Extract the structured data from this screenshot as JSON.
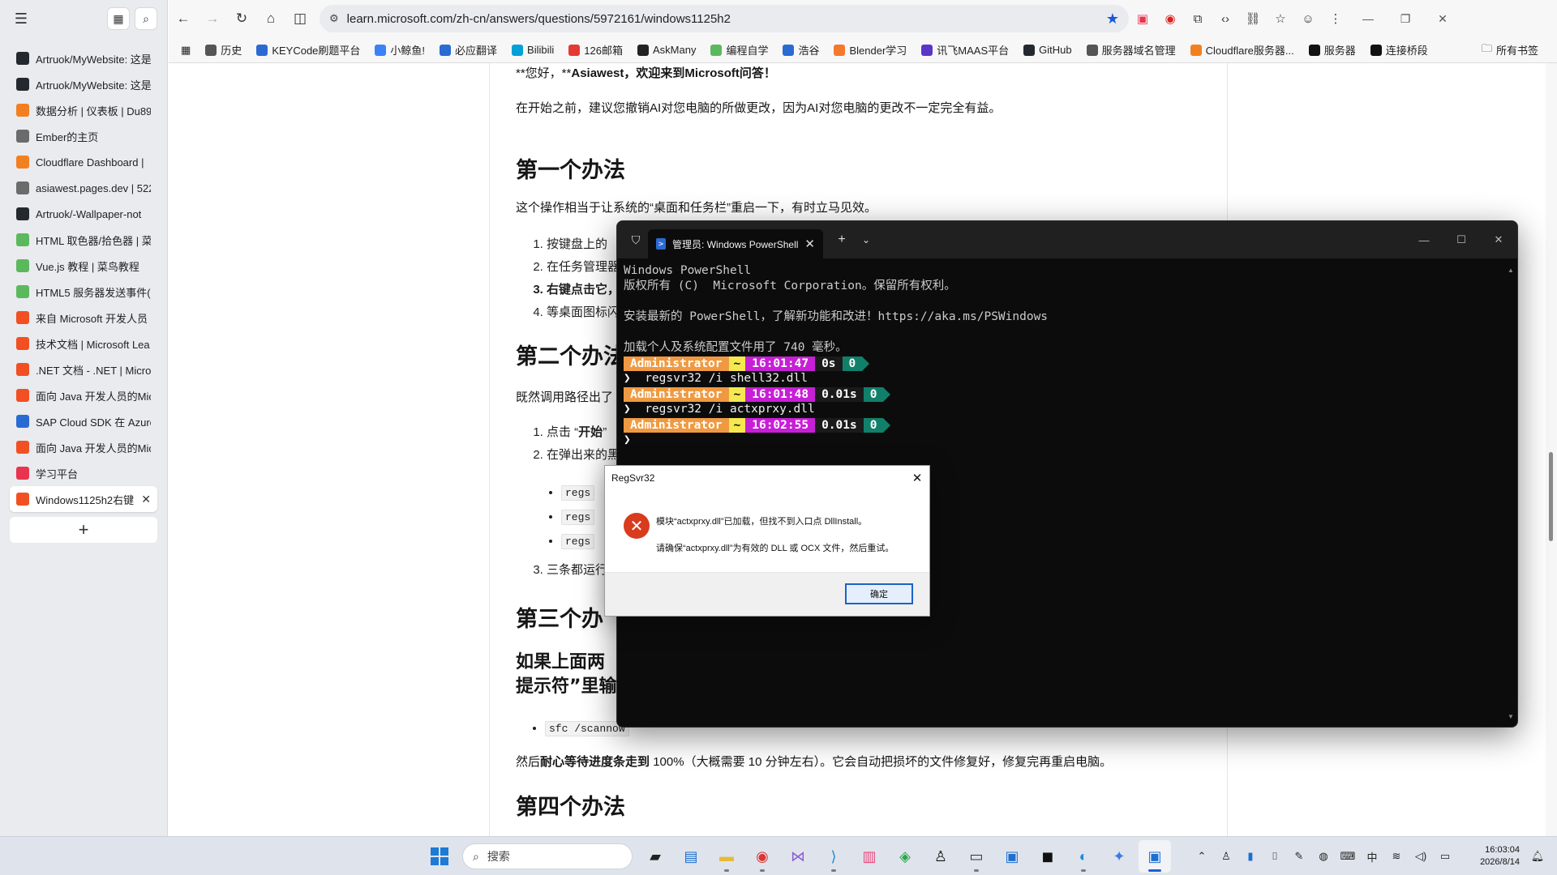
{
  "sidebar": {
    "items": [
      {
        "label": "Artruok/MyWebsite: 这是",
        "color": "#24292f"
      },
      {
        "label": "Artruok/MyWebsite: 这是",
        "color": "#24292f"
      },
      {
        "label": "数据分析 | 仪表板 | Du89",
        "color": "#f38020"
      },
      {
        "label": "Ember的主页",
        "color": "#6b6b6b"
      },
      {
        "label": "Cloudflare Dashboard | ",
        "color": "#f38020"
      },
      {
        "label": "asiawest.pages.dev | 522",
        "color": "#6b6b6b"
      },
      {
        "label": "Artruok/-Wallpaper-not",
        "color": "#24292f"
      },
      {
        "label": "HTML 取色器/拾色器 | 菜",
        "color": "#5cb85c"
      },
      {
        "label": "Vue.js 教程 | 菜鸟教程",
        "color": "#5cb85c"
      },
      {
        "label": "HTML5 服务器发送事件(S",
        "color": "#5cb85c"
      },
      {
        "label": "来自 Microsoft 开发人员",
        "color": "#f25022"
      },
      {
        "label": "技术文档 | Microsoft Lea",
        "color": "#f25022"
      },
      {
        "label": ".NET 文档 - .NET | Micro",
        "color": "#f25022"
      },
      {
        "label": "面向 Java 开发人员的Mic",
        "color": "#f25022"
      },
      {
        "label": "SAP Cloud SDK 在 Azure",
        "color": "#2a6bd3"
      },
      {
        "label": "面向 Java 开发人员的Mic",
        "color": "#f25022"
      },
      {
        "label": "学习平台",
        "color": "#e8344e"
      },
      {
        "label": "Windows1125h2右键",
        "color": "#f25022"
      }
    ],
    "new_tab": "+"
  },
  "topbar": {
    "url": "learn.microsoft.com/zh-cn/answers/questions/5972161/windows1125h2"
  },
  "bookmarks": [
    {
      "label": "历史",
      "color": "#555"
    },
    {
      "label": "KEYCode刷题平台",
      "color": "#2a6bd3"
    },
    {
      "label": "小鲸鱼!",
      "color": "#3b82f6"
    },
    {
      "label": "必应翻译",
      "color": "#2a6bd3"
    },
    {
      "label": "Bilibili",
      "color": "#00a1d6"
    },
    {
      "label": "126邮箱",
      "color": "#e53935"
    },
    {
      "label": "AskMany",
      "color": "#222"
    },
    {
      "label": "编程自学",
      "color": "#5cb85c"
    },
    {
      "label": "浩谷",
      "color": "#2a6bd3"
    },
    {
      "label": "Blender学习",
      "color": "#f5792a"
    },
    {
      "label": "讯飞MAAS平台",
      "color": "#5b34c9"
    },
    {
      "label": "GitHub",
      "color": "#24292f"
    },
    {
      "label": "服务器域名管理",
      "color": "#555"
    },
    {
      "label": "Cloudflare服务器...",
      "color": "#f38020"
    },
    {
      "label": "服务器",
      "color": "#111"
    },
    {
      "label": "连接桥段",
      "color": "#111"
    }
  ],
  "bookmarks_all": "所有书签",
  "article": {
    "greeting_prefix": "**您好，**",
    "greeting_name": "Asiawest",
    "greeting_suffix": "，欢迎来到Microsoft问答！",
    "intro": "在开始之前，建议您撤销AI对您电脑的所做更改，因为AI对您电脑的更改不一定完全有益。",
    "h_method1": "第一个办法",
    "m1_desc": "这个操作相当于让系统的“桌面和任务栏”重启一下，有时立马见效。",
    "m1_steps": [
      "按键盘上的",
      "在任务管理器",
      "右键点击它，",
      "等桌面图标闪"
    ],
    "h_method2": "第二个办法",
    "m2_desc": "既然调用路径出了",
    "m2_step1_a": "点击 “",
    "m2_step1_b": "开始",
    "m2_step1_c": "”",
    "m2_step2": "在弹出来的黑",
    "m2_codes": [
      "regs",
      "regs",
      "regs"
    ],
    "m2_step3": "三条都运行",
    "h_method3": "第三个办",
    "m3_sub_line1": "如果上面两",
    "m3_sub_line2": "提示符”里输",
    "m3_code": "sfc /scannow",
    "m3_desc_a": "然后",
    "m3_desc_b": "耐心等待进度条走到",
    "m3_desc_c": " 100%（大概需要 10 分钟左右）。它会自动把损坏的文件修复好，修复完再重启电脑。",
    "h_method4": "第四个办法"
  },
  "powershell": {
    "tab_title": "管理员: Windows PowerShell",
    "lines": [
      "Windows PowerShell",
      "版权所有 (C)  Microsoft Corporation。保留所有权利。",
      "",
      "安装最新的 PowerShell，了解新功能和改进！https://aka.ms/PSWindows",
      "",
      "加载个人及系统配置文件用了 740 毫秒。"
    ],
    "prompts": [
      {
        "user": "Administrator",
        "home": "~",
        "time": "16:01:47",
        "dur": "0s",
        "code": "0",
        "cmd": "regsvr32 /i shell32.dll"
      },
      {
        "user": "Administrator",
        "home": "~",
        "time": "16:01:48",
        "dur": "0.01s",
        "code": "0",
        "cmd": "regsvr32 /i actxprxy.dll"
      },
      {
        "user": "Administrator",
        "home": "~",
        "time": "16:02:55",
        "dur": "0.01s",
        "code": "0",
        "cmd": ""
      }
    ],
    "prompt_char": "❯"
  },
  "dialog": {
    "title": "RegSvr32",
    "message1": "模块“actxprxy.dll”已加载，但找不到入口点 DllInstall。",
    "message2": "请确保“actxprxy.dll”为有效的 DLL 或 OCX 文件，然后重试。",
    "ok": "确定"
  },
  "taskbar": {
    "search": "搜索",
    "ime": "中",
    "time": "16:03:04",
    "date": "2026/8/14"
  }
}
